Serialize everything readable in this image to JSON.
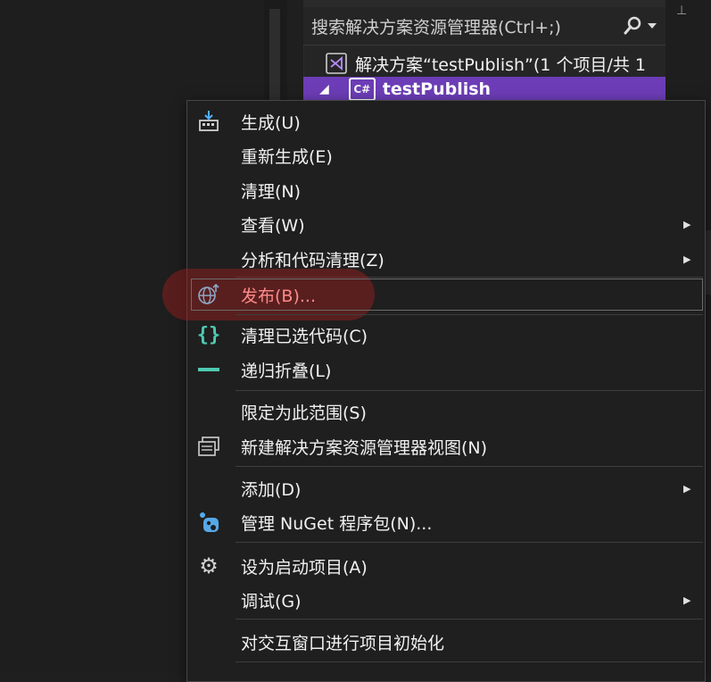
{
  "solution_explorer": {
    "search_placeholder": "搜索解决方案资源管理器(Ctrl+;)",
    "search_icon": "search-icon",
    "solution_label": "解决方案“testPublish”(1 个项目/共 1",
    "project_label": "testPublish",
    "project_badge": "C#",
    "accent": "#6c3db6"
  },
  "context_menu": {
    "items": [
      {
        "label": "生成(U)",
        "icon": "build-icon"
      },
      {
        "label": "重新生成(E)"
      },
      {
        "label": "清理(N)"
      },
      {
        "label": "查看(W)",
        "submenu": true
      },
      {
        "label": "分析和代码清理(Z)",
        "submenu": true
      },
      {
        "label": "发布(B)...",
        "icon": "publish-globe-icon",
        "highlighted": true
      },
      {
        "label": "清理已选代码(C)",
        "icon": "braces-icon"
      },
      {
        "label": "递归折叠(L)",
        "icon": "collapse-icon"
      },
      {
        "label": "限定为此范围(S)"
      },
      {
        "label": "新建解决方案资源管理器视图(N)",
        "icon": "new-view-icon"
      },
      {
        "label": "添加(D)",
        "submenu": true
      },
      {
        "label": "管理 NuGet 程序包(N)...",
        "icon": "nuget-icon"
      },
      {
        "label": "设为启动项目(A)",
        "icon": "gear-icon"
      },
      {
        "label": "调试(G)",
        "submenu": true
      },
      {
        "label": "对交互窗口进行项目初始化"
      }
    ],
    "highlight_color": "#ff8a8a"
  }
}
